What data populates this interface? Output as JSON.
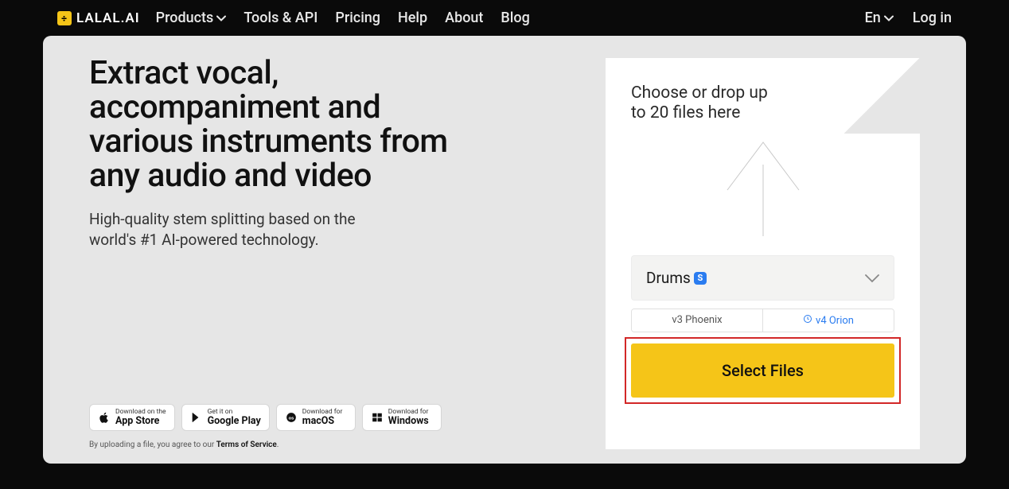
{
  "brand": {
    "name": "LALAL.AI"
  },
  "nav": {
    "products": "Products",
    "tools": "Tools & API",
    "pricing": "Pricing",
    "help": "Help",
    "about": "About",
    "blog": "Blog"
  },
  "lang": {
    "label": "En"
  },
  "login": {
    "label": "Log in"
  },
  "hero": {
    "headline": "Extract vocal, accompaniment and various instruments from any audio and video",
    "subhead": "High-quality stem splitting based on the world's #1 AI-powered technology."
  },
  "stores": {
    "appstore": {
      "small": "Download on the",
      "big": "App Store"
    },
    "google": {
      "small": "Get it on",
      "big": "Google Play"
    },
    "macos": {
      "small": "Download for",
      "big": "macOS"
    },
    "windows": {
      "small": "Download for",
      "big": "Windows"
    }
  },
  "terms": {
    "prefix": "By uploading a file, you agree to our ",
    "link": "Terms of Service",
    "suffix": "."
  },
  "upload": {
    "drop_text": "Choose or drop up to 20 files here",
    "stem": {
      "selected": "Drums",
      "badge": "S"
    },
    "versions": {
      "v3": "v3 Phoenix",
      "v4": "v4 Orion"
    },
    "select_button": "Select Files"
  }
}
